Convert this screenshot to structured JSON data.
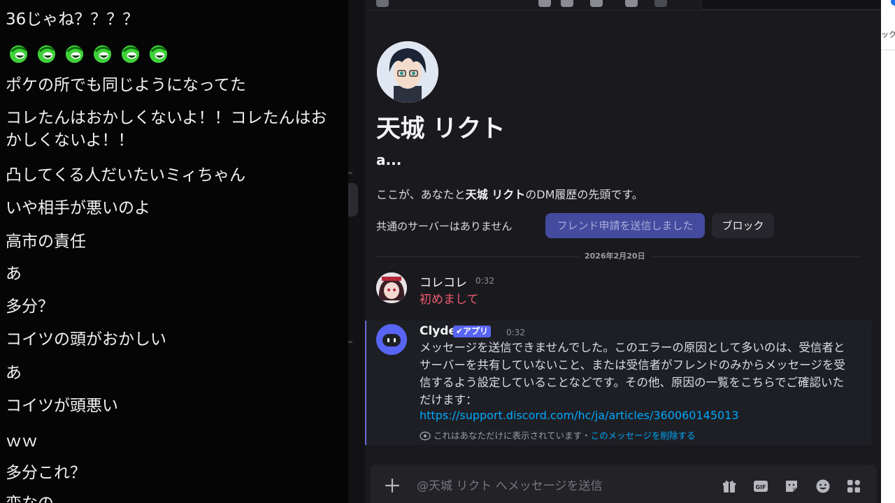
{
  "chat": {
    "lines": [
      "36じゃね？？？？",
      "ポケの所でも同じようになってた",
      "コレたんはおかしくないよ！！コレたんはおかしくないよ！！",
      "凸してくる人だいたいミィちゃん",
      "いや相手が悪いのよ",
      "高市の責任",
      "あ",
      "多分？",
      "コイツの頭がおかしい",
      "あ",
      "コイツが頭悪い",
      "ｗｗ",
      "多分これ？",
      "変なの"
    ],
    "emotes": [
      "green-laugh-emote",
      "green-laugh-emote",
      "green-laugh-emote",
      "green-laugh-emote",
      "green-laugh-emote",
      "green-laugh-emote"
    ]
  },
  "profile": {
    "name": "天城 リクト",
    "handle": "a...",
    "intro_pre": "ここが、あなたと",
    "intro_name": "天城 リクト",
    "intro_post": "のDM履歴の先頭です。",
    "mutual": "共通のサーバーはありません",
    "friend_button": "フレンド申請を送信しました",
    "block_button": "ブロック"
  },
  "date_divider": "2026年2月20日",
  "messages": [
    {
      "author": "コレコレ",
      "time": "0:32",
      "text": "初めまして",
      "color": "#ef5b72"
    },
    {
      "author": "Clyde",
      "badge": "✔アプリ",
      "time": "0:32",
      "text": "メッセージを送信できませんでした。このエラーの原因として多いのは、受信者とサーバーを共有していないこと、または受信者がフレンドのみからメッセージを受信するよう設定していることなどです。その他、原因の一覧をこちらでご確認いただけます：",
      "link": "https://support.discord.com/hc/ja/articles/360060145013",
      "note": "これはあなただけに表示されています・",
      "note_link": "このメッセージを削除する"
    }
  ],
  "composer": {
    "placeholder": "@天城 リクト へメッセージを送信",
    "tools": [
      "gift-icon",
      "gif-icon",
      "sticker-icon",
      "emoji-icon",
      "apps-icon"
    ]
  },
  "right_panel": {
    "text": "ックマ"
  },
  "colors": {
    "accent": "#5865f2",
    "link": "#00a8fc",
    "background": "#1a1a1e"
  }
}
